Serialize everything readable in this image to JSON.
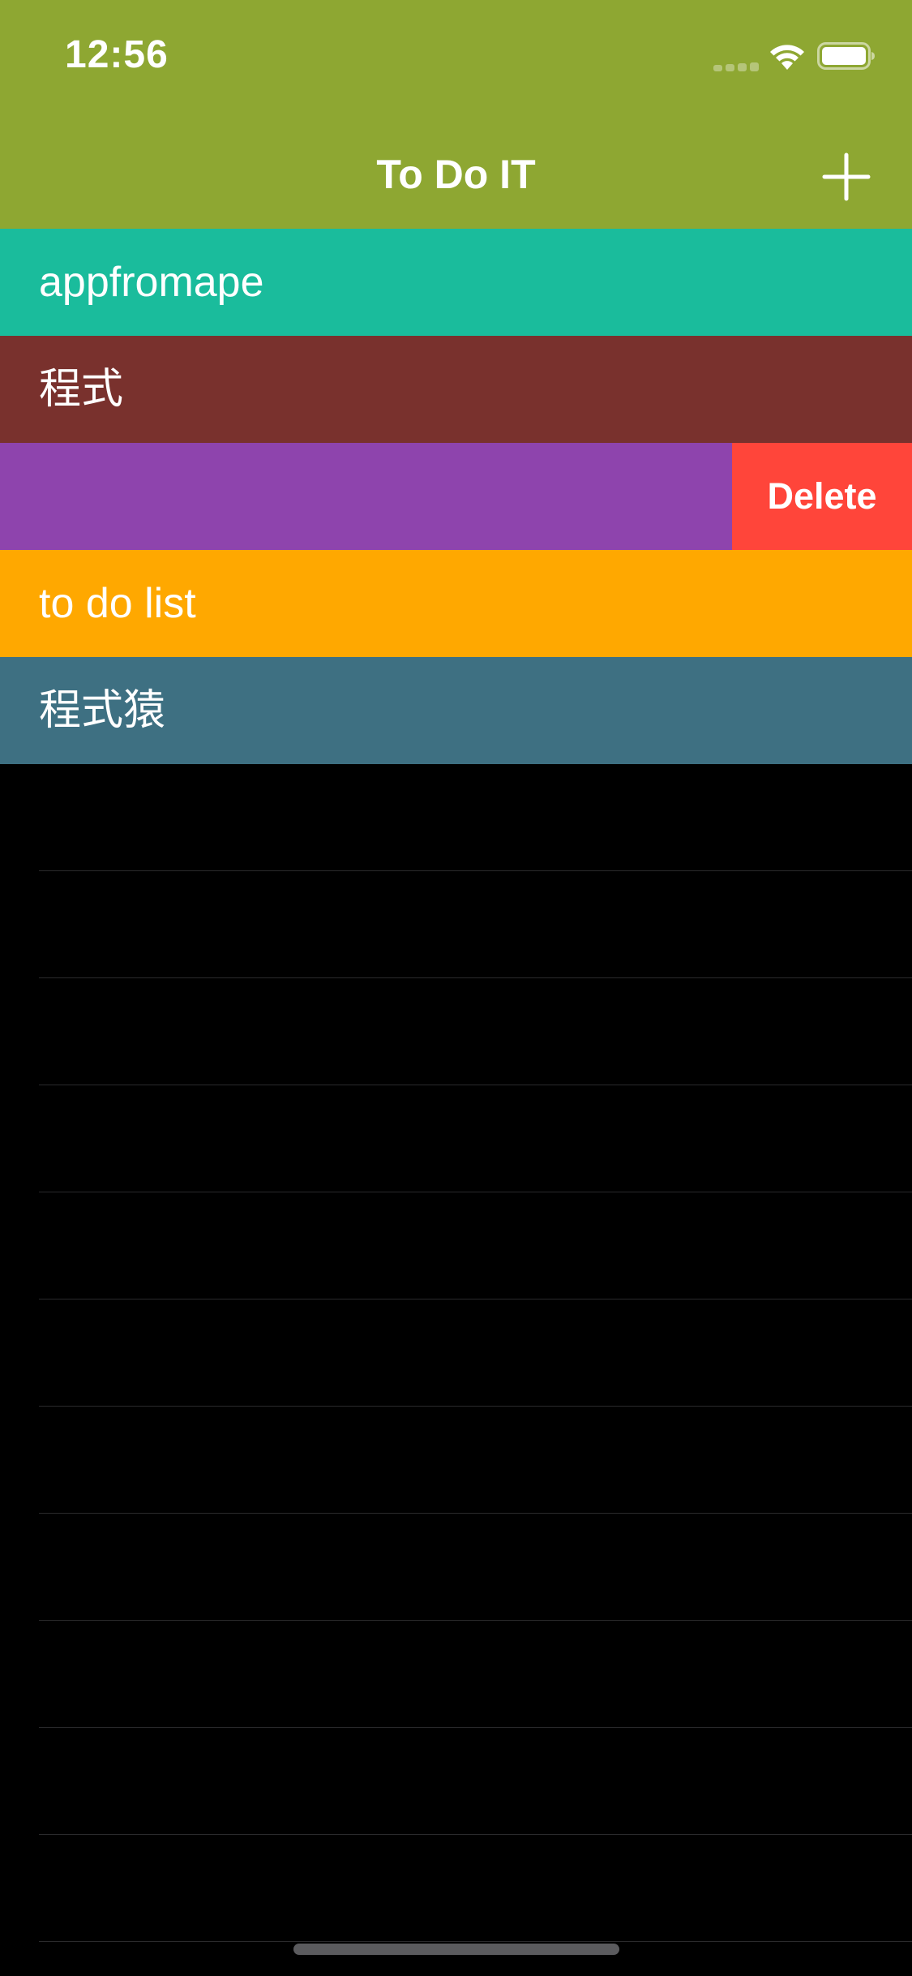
{
  "status_bar": {
    "time": "12:56"
  },
  "nav_bar": {
    "title": "To Do IT",
    "background": "#8EA732",
    "add_icon": "plus-icon"
  },
  "items": [
    {
      "label": "appfromape",
      "color": "#1ABC9C",
      "swiped": false
    },
    {
      "label": "程式",
      "color": "#79312D",
      "swiped": false
    },
    {
      "label": "",
      "color": "#8E44AD",
      "swiped": true
    },
    {
      "label": "to do list",
      "color": "#FFA800",
      "swiped": false
    },
    {
      "label": "程式猿",
      "color": "#3E7082",
      "swiped": false
    }
  ],
  "swipe_action": {
    "label": "Delete",
    "color": "#FF453A"
  },
  "empty_background": "#000000"
}
